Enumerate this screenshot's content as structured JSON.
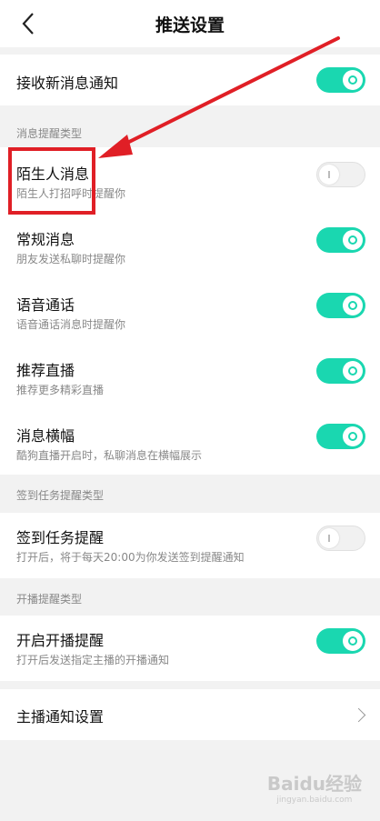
{
  "header": {
    "title": "推送设置"
  },
  "main_toggle": {
    "label": "接收新消息通知",
    "on": true
  },
  "sections": [
    {
      "label": "消息提醒类型",
      "items": [
        {
          "title": "陌生人消息",
          "subtitle": "陌生人打招呼时提醒你",
          "on": false
        },
        {
          "title": "常规消息",
          "subtitle": "朋友发送私聊时提醒你",
          "on": true
        },
        {
          "title": "语音通话",
          "subtitle": "语音通话消息时提醒你",
          "on": true
        },
        {
          "title": "推荐直播",
          "subtitle": "推荐更多精彩直播",
          "on": true
        },
        {
          "title": "消息横幅",
          "subtitle": "酷狗直播开启时，私聊消息在横幅展示",
          "on": true
        }
      ]
    },
    {
      "label": "签到任务提醒类型",
      "items": [
        {
          "title": "签到任务提醒",
          "subtitle": "打开后，将于每天20:00为你发送签到提醒通知",
          "on": false
        }
      ]
    },
    {
      "label": "开播提醒类型",
      "items": [
        {
          "title": "开启开播提醒",
          "subtitle": "打开后发送指定主播的开播通知",
          "on": true
        }
      ]
    }
  ],
  "anchor_setting": {
    "label": "主播通知设置"
  },
  "watermark": {
    "big": "Baidu经验",
    "small": "jingyan.baidu.com"
  },
  "colors": {
    "accent": "#1ad7b0",
    "highlight": "#e01f26"
  },
  "icons": {
    "back": "chevron-left-icon",
    "more": "chevron-right-icon"
  }
}
